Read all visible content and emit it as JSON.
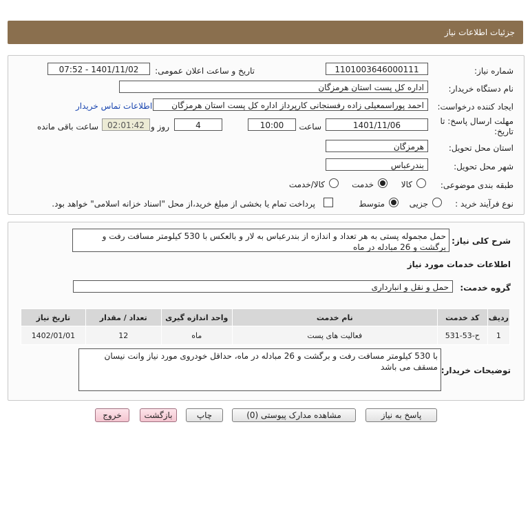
{
  "header": {
    "title": "جزئیات اطلاعات نیاز"
  },
  "form": {
    "need_number_label": "شماره نیاز:",
    "need_number": "1101003646000111",
    "announce_label": "تاریخ و ساعت اعلان عمومی:",
    "announce_value": "1401/11/02 - 07:52",
    "buyer_org_label": "نام دستگاه خریدار:",
    "buyer_org": "اداره کل پست استان هرمزگان",
    "creator_label": "ایجاد کننده درخواست:",
    "creator": "احمد پوراسمعیلی زاده رفسنجانی کارپرداز اداره کل پست استان هرمزگان",
    "contact_link": "اطلاعات تماس خریدار",
    "deadline_label_1": "مهلت ارسال پاسخ: تا",
    "deadline_label_2": "تاریخ:",
    "deadline_date": "1401/11/06",
    "time_label": "ساعت",
    "deadline_time": "10:00",
    "days_value": "4",
    "days_label": "روز و",
    "remaining_time": "02:01:42",
    "remaining_label": "ساعت باقی مانده",
    "province_label": "استان محل تحویل:",
    "province": "هرمزگان",
    "city_label": "شهر محل تحویل:",
    "city": "بندرعباس",
    "category_label": "طبقه بندی موضوعی:",
    "category_options": [
      "کالا",
      "خدمت",
      "کالا/خدمت"
    ],
    "category_selected": "خدمت",
    "process_label": "نوع فرآیند خرید :",
    "process_options": [
      "جزیی",
      "متوسط"
    ],
    "process_selected": "متوسط",
    "payment_note": "پرداخت تمام یا بخشی از مبلغ خرید،از محل \"اسناد خزانه اسلامی\" خواهد بود."
  },
  "details": {
    "summary_label": "شرح کلی نیاز:",
    "summary": "حمل مجموله پستی به هر تعداد و اندازه از بندرعباس به لار و بالعکس با 530 کیلومتر مسافت رفت و برگشت و 26 مبادله در ماه",
    "services_title": "اطلاعات خدمات مورد نیاز",
    "service_group_label": "گروه خدمت:",
    "service_group": "حمل و نقل و انبارداری",
    "table": {
      "headers": [
        "ردیف",
        "کد خدمت",
        "نام خدمت",
        "واحد اندازه گیری",
        "تعداد / مقدار",
        "تاریخ نیاز"
      ],
      "rows": [
        [
          "1",
          "ح-53-531",
          "فعالیت های پست",
          "ماه",
          "12",
          "1402/01/01"
        ]
      ]
    },
    "buyer_notes_label": "توضیحات خریدار:",
    "buyer_notes": "با 530 کیلومتر مسافت رفت و برگشت و 26 مبادله در ماه، حداقل خودروی مورد نیاز وانت نیسان مسقف می باشد"
  },
  "buttons": {
    "reply": "پاسخ به نیاز",
    "attachments": "مشاهده مدارک پیوستی (0)",
    "print": "چاپ",
    "back": "بازگشت",
    "exit": "خروج"
  }
}
